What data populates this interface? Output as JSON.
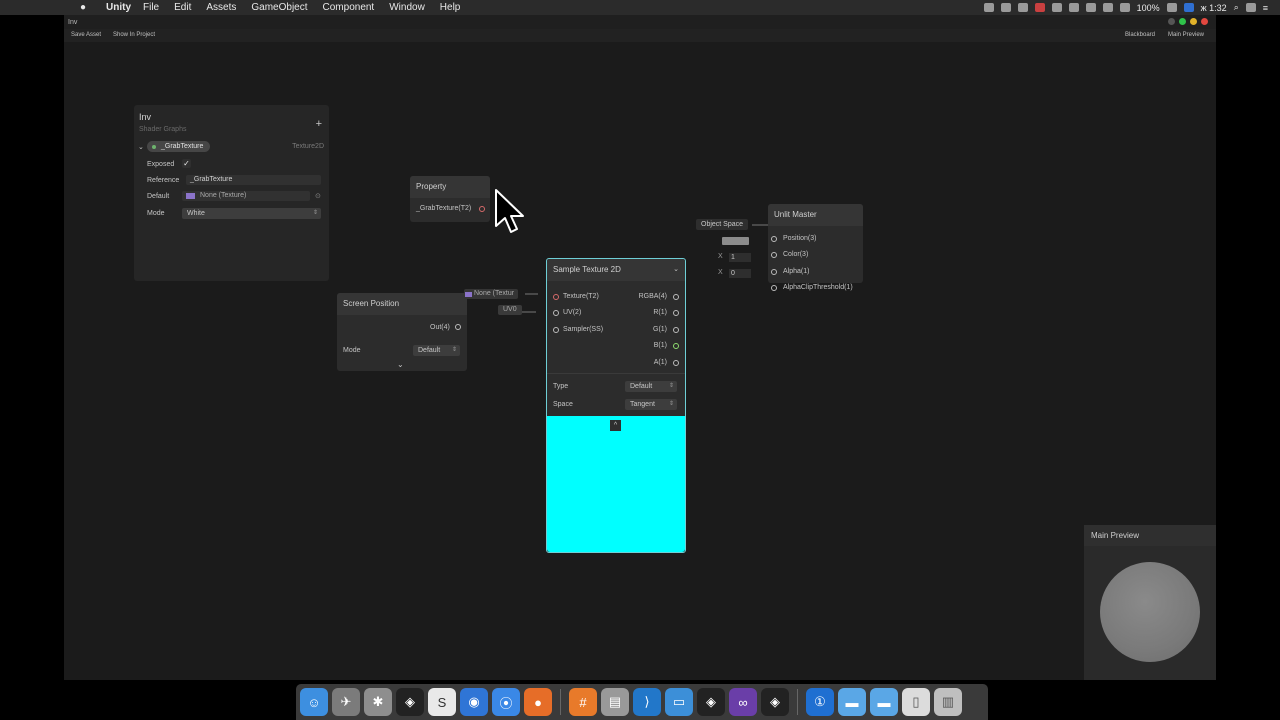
{
  "menubar": {
    "app_name": "Unity",
    "menus": [
      "File",
      "Edit",
      "Assets",
      "GameObject",
      "Component",
      "Window",
      "Help"
    ],
    "battery": "100%",
    "clock": "ж 1:32"
  },
  "window": {
    "tab_label": "Inv",
    "toolbar": {
      "save_asset": "Save Asset",
      "show_in_project": "Show In Project",
      "blackboard": "Blackboard",
      "main_preview": "Main Preview"
    }
  },
  "blackboard": {
    "title": "Inv",
    "subtitle": "Shader Graphs",
    "add": "+",
    "property": {
      "name": "_GrabTexture",
      "type": "Texture2D",
      "exposed_label": "Exposed",
      "exposed_check": "✓",
      "reference_label": "Reference",
      "reference_value": "_GrabTexture",
      "default_label": "Default",
      "default_value": "None (Texture)",
      "mode_label": "Mode",
      "mode_value": "White"
    }
  },
  "property_node": {
    "title": "Property",
    "output": "_GrabTexture(T2)"
  },
  "screen_position_node": {
    "title": "Screen Position",
    "output": "Out(4)",
    "mode_label": "Mode",
    "mode_value": "Default",
    "expand": "⌄"
  },
  "sample_texture_node": {
    "title": "Sample Texture 2D",
    "collapse": "⌄",
    "inputs": [
      "Texture(T2)",
      "UV(2)",
      "Sampler(SS)"
    ],
    "outputs": [
      "RGBA(4)",
      "R(1)",
      "G(1)",
      "B(1)",
      "A(1)"
    ],
    "input_defaults": {
      "texture": "None (Textur",
      "uv": "UV0"
    },
    "type_label": "Type",
    "type_value": "Default",
    "space_label": "Space",
    "space_value": "Tangent",
    "preview_color": "#00ffff",
    "preview_toggle": "^"
  },
  "unlit_master_node": {
    "title": "Unlit Master",
    "inputs": [
      "Position(3)",
      "Color(3)",
      "Alpha(1)",
      "AlphaClipThreshold(1)"
    ],
    "position_default": "Object Space",
    "alpha_default_x": "X",
    "alpha_default": "1",
    "clip_default_x": "X",
    "clip_default": "0"
  },
  "main_preview": {
    "title": "Main Preview"
  },
  "dock": {
    "icons": [
      "finder-icon",
      "launchpad-icon",
      "utility-icon",
      "unity-icon",
      "slack-icon",
      "chrome-icon",
      "maps-icon",
      "firefox-icon",
      "hash-icon",
      "notes-icon",
      "vscode-icon",
      "keynote-icon",
      "unity-hub-icon",
      "visual-studio-icon",
      "unity-app-icon",
      "1password-icon",
      "folder-icon",
      "folder-icon-2",
      "document-icon",
      "trash-icon"
    ]
  }
}
